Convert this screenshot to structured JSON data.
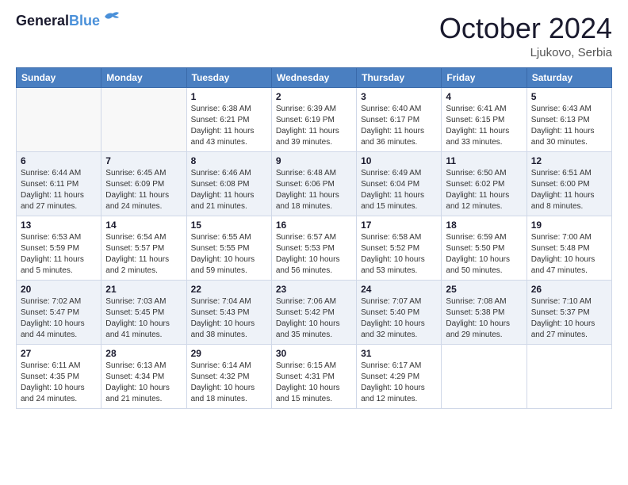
{
  "header": {
    "logo_general": "General",
    "logo_blue": "Blue",
    "month_title": "October 2024",
    "location": "Ljukovo, Serbia"
  },
  "days_of_week": [
    "Sunday",
    "Monday",
    "Tuesday",
    "Wednesday",
    "Thursday",
    "Friday",
    "Saturday"
  ],
  "weeks": [
    {
      "days": [
        {
          "num": "",
          "sunrise": "",
          "sunset": "",
          "daylight": ""
        },
        {
          "num": "",
          "sunrise": "",
          "sunset": "",
          "daylight": ""
        },
        {
          "num": "1",
          "sunrise": "Sunrise: 6:38 AM",
          "sunset": "Sunset: 6:21 PM",
          "daylight": "Daylight: 11 hours and 43 minutes."
        },
        {
          "num": "2",
          "sunrise": "Sunrise: 6:39 AM",
          "sunset": "Sunset: 6:19 PM",
          "daylight": "Daylight: 11 hours and 39 minutes."
        },
        {
          "num": "3",
          "sunrise": "Sunrise: 6:40 AM",
          "sunset": "Sunset: 6:17 PM",
          "daylight": "Daylight: 11 hours and 36 minutes."
        },
        {
          "num": "4",
          "sunrise": "Sunrise: 6:41 AM",
          "sunset": "Sunset: 6:15 PM",
          "daylight": "Daylight: 11 hours and 33 minutes."
        },
        {
          "num": "5",
          "sunrise": "Sunrise: 6:43 AM",
          "sunset": "Sunset: 6:13 PM",
          "daylight": "Daylight: 11 hours and 30 minutes."
        }
      ]
    },
    {
      "days": [
        {
          "num": "6",
          "sunrise": "Sunrise: 6:44 AM",
          "sunset": "Sunset: 6:11 PM",
          "daylight": "Daylight: 11 hours and 27 minutes."
        },
        {
          "num": "7",
          "sunrise": "Sunrise: 6:45 AM",
          "sunset": "Sunset: 6:09 PM",
          "daylight": "Daylight: 11 hours and 24 minutes."
        },
        {
          "num": "8",
          "sunrise": "Sunrise: 6:46 AM",
          "sunset": "Sunset: 6:08 PM",
          "daylight": "Daylight: 11 hours and 21 minutes."
        },
        {
          "num": "9",
          "sunrise": "Sunrise: 6:48 AM",
          "sunset": "Sunset: 6:06 PM",
          "daylight": "Daylight: 11 hours and 18 minutes."
        },
        {
          "num": "10",
          "sunrise": "Sunrise: 6:49 AM",
          "sunset": "Sunset: 6:04 PM",
          "daylight": "Daylight: 11 hours and 15 minutes."
        },
        {
          "num": "11",
          "sunrise": "Sunrise: 6:50 AM",
          "sunset": "Sunset: 6:02 PM",
          "daylight": "Daylight: 11 hours and 12 minutes."
        },
        {
          "num": "12",
          "sunrise": "Sunrise: 6:51 AM",
          "sunset": "Sunset: 6:00 PM",
          "daylight": "Daylight: 11 hours and 8 minutes."
        }
      ]
    },
    {
      "days": [
        {
          "num": "13",
          "sunrise": "Sunrise: 6:53 AM",
          "sunset": "Sunset: 5:59 PM",
          "daylight": "Daylight: 11 hours and 5 minutes."
        },
        {
          "num": "14",
          "sunrise": "Sunrise: 6:54 AM",
          "sunset": "Sunset: 5:57 PM",
          "daylight": "Daylight: 11 hours and 2 minutes."
        },
        {
          "num": "15",
          "sunrise": "Sunrise: 6:55 AM",
          "sunset": "Sunset: 5:55 PM",
          "daylight": "Daylight: 10 hours and 59 minutes."
        },
        {
          "num": "16",
          "sunrise": "Sunrise: 6:57 AM",
          "sunset": "Sunset: 5:53 PM",
          "daylight": "Daylight: 10 hours and 56 minutes."
        },
        {
          "num": "17",
          "sunrise": "Sunrise: 6:58 AM",
          "sunset": "Sunset: 5:52 PM",
          "daylight": "Daylight: 10 hours and 53 minutes."
        },
        {
          "num": "18",
          "sunrise": "Sunrise: 6:59 AM",
          "sunset": "Sunset: 5:50 PM",
          "daylight": "Daylight: 10 hours and 50 minutes."
        },
        {
          "num": "19",
          "sunrise": "Sunrise: 7:00 AM",
          "sunset": "Sunset: 5:48 PM",
          "daylight": "Daylight: 10 hours and 47 minutes."
        }
      ]
    },
    {
      "days": [
        {
          "num": "20",
          "sunrise": "Sunrise: 7:02 AM",
          "sunset": "Sunset: 5:47 PM",
          "daylight": "Daylight: 10 hours and 44 minutes."
        },
        {
          "num": "21",
          "sunrise": "Sunrise: 7:03 AM",
          "sunset": "Sunset: 5:45 PM",
          "daylight": "Daylight: 10 hours and 41 minutes."
        },
        {
          "num": "22",
          "sunrise": "Sunrise: 7:04 AM",
          "sunset": "Sunset: 5:43 PM",
          "daylight": "Daylight: 10 hours and 38 minutes."
        },
        {
          "num": "23",
          "sunrise": "Sunrise: 7:06 AM",
          "sunset": "Sunset: 5:42 PM",
          "daylight": "Daylight: 10 hours and 35 minutes."
        },
        {
          "num": "24",
          "sunrise": "Sunrise: 7:07 AM",
          "sunset": "Sunset: 5:40 PM",
          "daylight": "Daylight: 10 hours and 32 minutes."
        },
        {
          "num": "25",
          "sunrise": "Sunrise: 7:08 AM",
          "sunset": "Sunset: 5:38 PM",
          "daylight": "Daylight: 10 hours and 29 minutes."
        },
        {
          "num": "26",
          "sunrise": "Sunrise: 7:10 AM",
          "sunset": "Sunset: 5:37 PM",
          "daylight": "Daylight: 10 hours and 27 minutes."
        }
      ]
    },
    {
      "days": [
        {
          "num": "27",
          "sunrise": "Sunrise: 6:11 AM",
          "sunset": "Sunset: 4:35 PM",
          "daylight": "Daylight: 10 hours and 24 minutes."
        },
        {
          "num": "28",
          "sunrise": "Sunrise: 6:13 AM",
          "sunset": "Sunset: 4:34 PM",
          "daylight": "Daylight: 10 hours and 21 minutes."
        },
        {
          "num": "29",
          "sunrise": "Sunrise: 6:14 AM",
          "sunset": "Sunset: 4:32 PM",
          "daylight": "Daylight: 10 hours and 18 minutes."
        },
        {
          "num": "30",
          "sunrise": "Sunrise: 6:15 AM",
          "sunset": "Sunset: 4:31 PM",
          "daylight": "Daylight: 10 hours and 15 minutes."
        },
        {
          "num": "31",
          "sunrise": "Sunrise: 6:17 AM",
          "sunset": "Sunset: 4:29 PM",
          "daylight": "Daylight: 10 hours and 12 minutes."
        },
        {
          "num": "",
          "sunrise": "",
          "sunset": "",
          "daylight": ""
        },
        {
          "num": "",
          "sunrise": "",
          "sunset": "",
          "daylight": ""
        }
      ]
    }
  ]
}
